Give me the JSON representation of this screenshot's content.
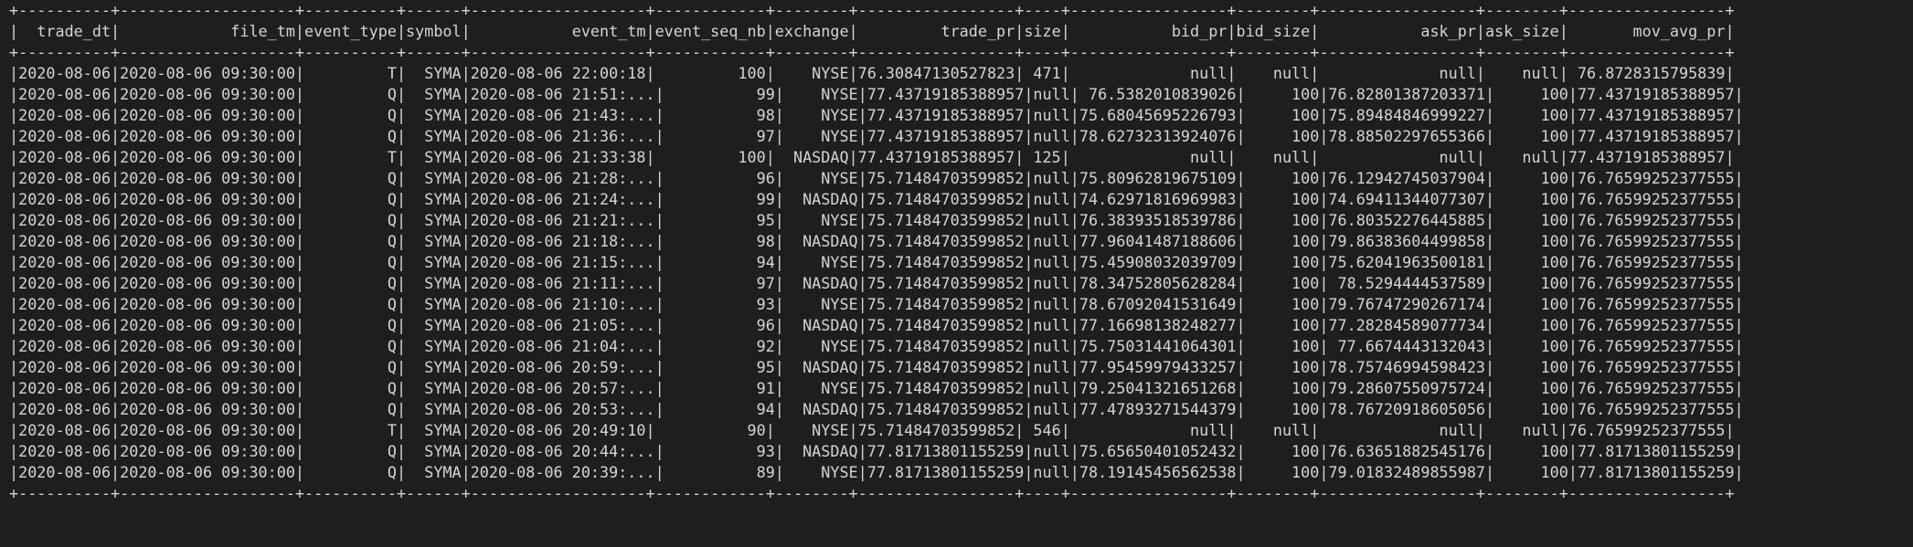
{
  "terminal": {
    "border_top": "+----------+-------------------+----------+------+-------------------+------------+--------+-----------------+----+-----------------+--------+-----------------+--------+-----------------+",
    "header": "|  trade_dt|            file_tm|event_type|symbol|           event_tm|event_seq_nb|exchange|         trade_pr|size|           bid_pr|bid_size|           ask_pr|ask_size|       mov_avg_pr|",
    "border_mid": "+----------+-------------------+----------+------+-------------------+------------+--------+-----------------+----+-----------------+--------+-----------------+--------+-----------------+",
    "rows": [
      "|2020-08-06|2020-08-06 09:30:00|         T|  SYMA|2020-08-06 22:00:18|         100|    NYSE|76.30847130527823| 471|             null|    null|             null|    null| 76.8728315795839|",
      "|2020-08-06|2020-08-06 09:30:00|         Q|  SYMA|2020-08-06 21:51:...|          99|    NYSE|77.43719185388957|null| 76.5382010839026|     100|76.82801387203371|     100|77.43719185388957|",
      "|2020-08-06|2020-08-06 09:30:00|         Q|  SYMA|2020-08-06 21:43:...|          98|    NYSE|77.43719185388957|null|75.68045695226793|     100|75.89484846999227|     100|77.43719185388957|",
      "|2020-08-06|2020-08-06 09:30:00|         Q|  SYMA|2020-08-06 21:36:...|          97|    NYSE|77.43719185388957|null|78.62732313924076|     100|78.88502297655366|     100|77.43719185388957|",
      "|2020-08-06|2020-08-06 09:30:00|         T|  SYMA|2020-08-06 21:33:38|         100|  NASDAQ|77.43719185388957| 125|             null|    null|             null|    null|77.43719185388957|",
      "|2020-08-06|2020-08-06 09:30:00|         Q|  SYMA|2020-08-06 21:28:...|          96|    NYSE|75.71484703599852|null|75.80962819675109|     100|76.12942745037904|     100|76.76599252377555|",
      "|2020-08-06|2020-08-06 09:30:00|         Q|  SYMA|2020-08-06 21:24:...|          99|  NASDAQ|75.71484703599852|null|74.62971816969983|     100|74.69411344077307|     100|76.76599252377555|",
      "|2020-08-06|2020-08-06 09:30:00|         Q|  SYMA|2020-08-06 21:21:...|          95|    NYSE|75.71484703599852|null|76.38393518539786|     100|76.80352276445885|     100|76.76599252377555|",
      "|2020-08-06|2020-08-06 09:30:00|         Q|  SYMA|2020-08-06 21:18:...|          98|  NASDAQ|75.71484703599852|null|77.96041487188606|     100|79.86383604499858|     100|76.76599252377555|",
      "|2020-08-06|2020-08-06 09:30:00|         Q|  SYMA|2020-08-06 21:15:...|          94|    NYSE|75.71484703599852|null|75.45908032039709|     100|75.62041963500181|     100|76.76599252377555|",
      "|2020-08-06|2020-08-06 09:30:00|         Q|  SYMA|2020-08-06 21:11:...|          97|  NASDAQ|75.71484703599852|null|78.34752805628284|     100| 78.5294444537589|     100|76.76599252377555|",
      "|2020-08-06|2020-08-06 09:30:00|         Q|  SYMA|2020-08-06 21:10:...|          93|    NYSE|75.71484703599852|null|78.67092041531649|     100|79.76747290267174|     100|76.76599252377555|",
      "|2020-08-06|2020-08-06 09:30:00|         Q|  SYMA|2020-08-06 21:05:...|          96|  NASDAQ|75.71484703599852|null|77.16698138248277|     100|77.28284589077734|     100|76.76599252377555|",
      "|2020-08-06|2020-08-06 09:30:00|         Q|  SYMA|2020-08-06 21:04:...|          92|    NYSE|75.71484703599852|null|75.75031441064301|     100| 77.6674443132043|     100|76.76599252377555|",
      "|2020-08-06|2020-08-06 09:30:00|         Q|  SYMA|2020-08-06 20:59:...|          95|  NASDAQ|75.71484703599852|null|77.95459979433257|     100|78.75746994598423|     100|76.76599252377555|",
      "|2020-08-06|2020-08-06 09:30:00|         Q|  SYMA|2020-08-06 20:57:...|          91|    NYSE|75.71484703599852|null|79.25041321651268|     100|79.28607550975724|     100|76.76599252377555|",
      "|2020-08-06|2020-08-06 09:30:00|         Q|  SYMA|2020-08-06 20:53:...|          94|  NASDAQ|75.71484703599852|null|77.47893271544379|     100|78.76720918605056|     100|76.76599252377555|",
      "|2020-08-06|2020-08-06 09:30:00|         T|  SYMA|2020-08-06 20:49:10|          90|    NYSE|75.71484703599852| 546|             null|    null|             null|    null|76.76599252377555|",
      "|2020-08-06|2020-08-06 09:30:00|         Q|  SYMA|2020-08-06 20:44:...|          93|  NASDAQ|77.81713801155259|null|75.65650401052432|     100|76.63651882545176|     100|77.81713801155259|",
      "|2020-08-06|2020-08-06 09:30:00|         Q|  SYMA|2020-08-06 20:39:...|          89|    NYSE|77.81713801155259|null|78.19145456562538|     100|79.01832489855987|     100|77.81713801155259|"
    ],
    "border_bottom": "+----------+-------------------+----------+------+-------------------+------------+--------+-----------------+----+-----------------+--------+-----------------+--------+-----------------+"
  },
  "colors": {
    "background": "#1e1e1e",
    "text": "#d4d4d4"
  }
}
